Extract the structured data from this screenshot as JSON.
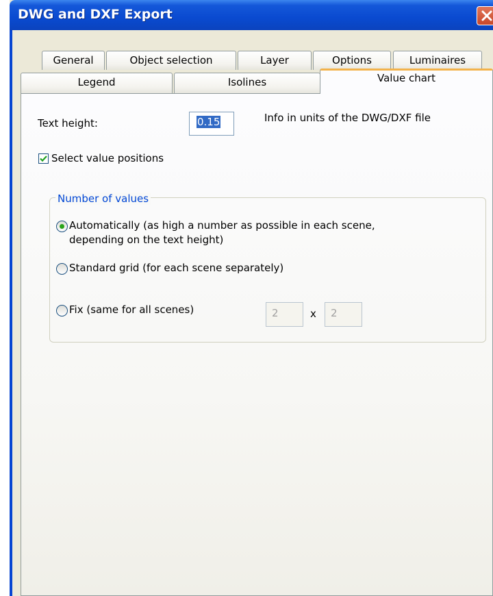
{
  "window": {
    "title": "DWG and DXF Export"
  },
  "tabs_row1": [
    "General",
    "Object selection",
    "Layer",
    "Options",
    "Luminaires"
  ],
  "tabs_row2": [
    "Legend",
    "Isolines",
    "Value chart"
  ],
  "active_tab": "Value chart",
  "value_chart": {
    "text_height_label": "Text height:",
    "text_height_value": "0.15",
    "units_info": "Info in units of the DWG/DXF file",
    "select_positions_label": "Select value positions",
    "select_positions_checked": true,
    "group_title": "Number of values",
    "options": {
      "auto_line1": "Automatically (as high a number as possible in each scene,",
      "auto_line2": "depending on the text height)",
      "standard": "Standard grid (for each scene separately)",
      "fix": "Fix (same for all scenes)"
    },
    "selected_option": "auto",
    "fix_x": "2",
    "fix_sep": "x",
    "fix_y": "2"
  },
  "colors": {
    "titlebar": "#0a4ad0",
    "active_tab_accent": "#f3b24a",
    "group_label": "#0046d5",
    "radio_dot": "#2ba31b"
  }
}
